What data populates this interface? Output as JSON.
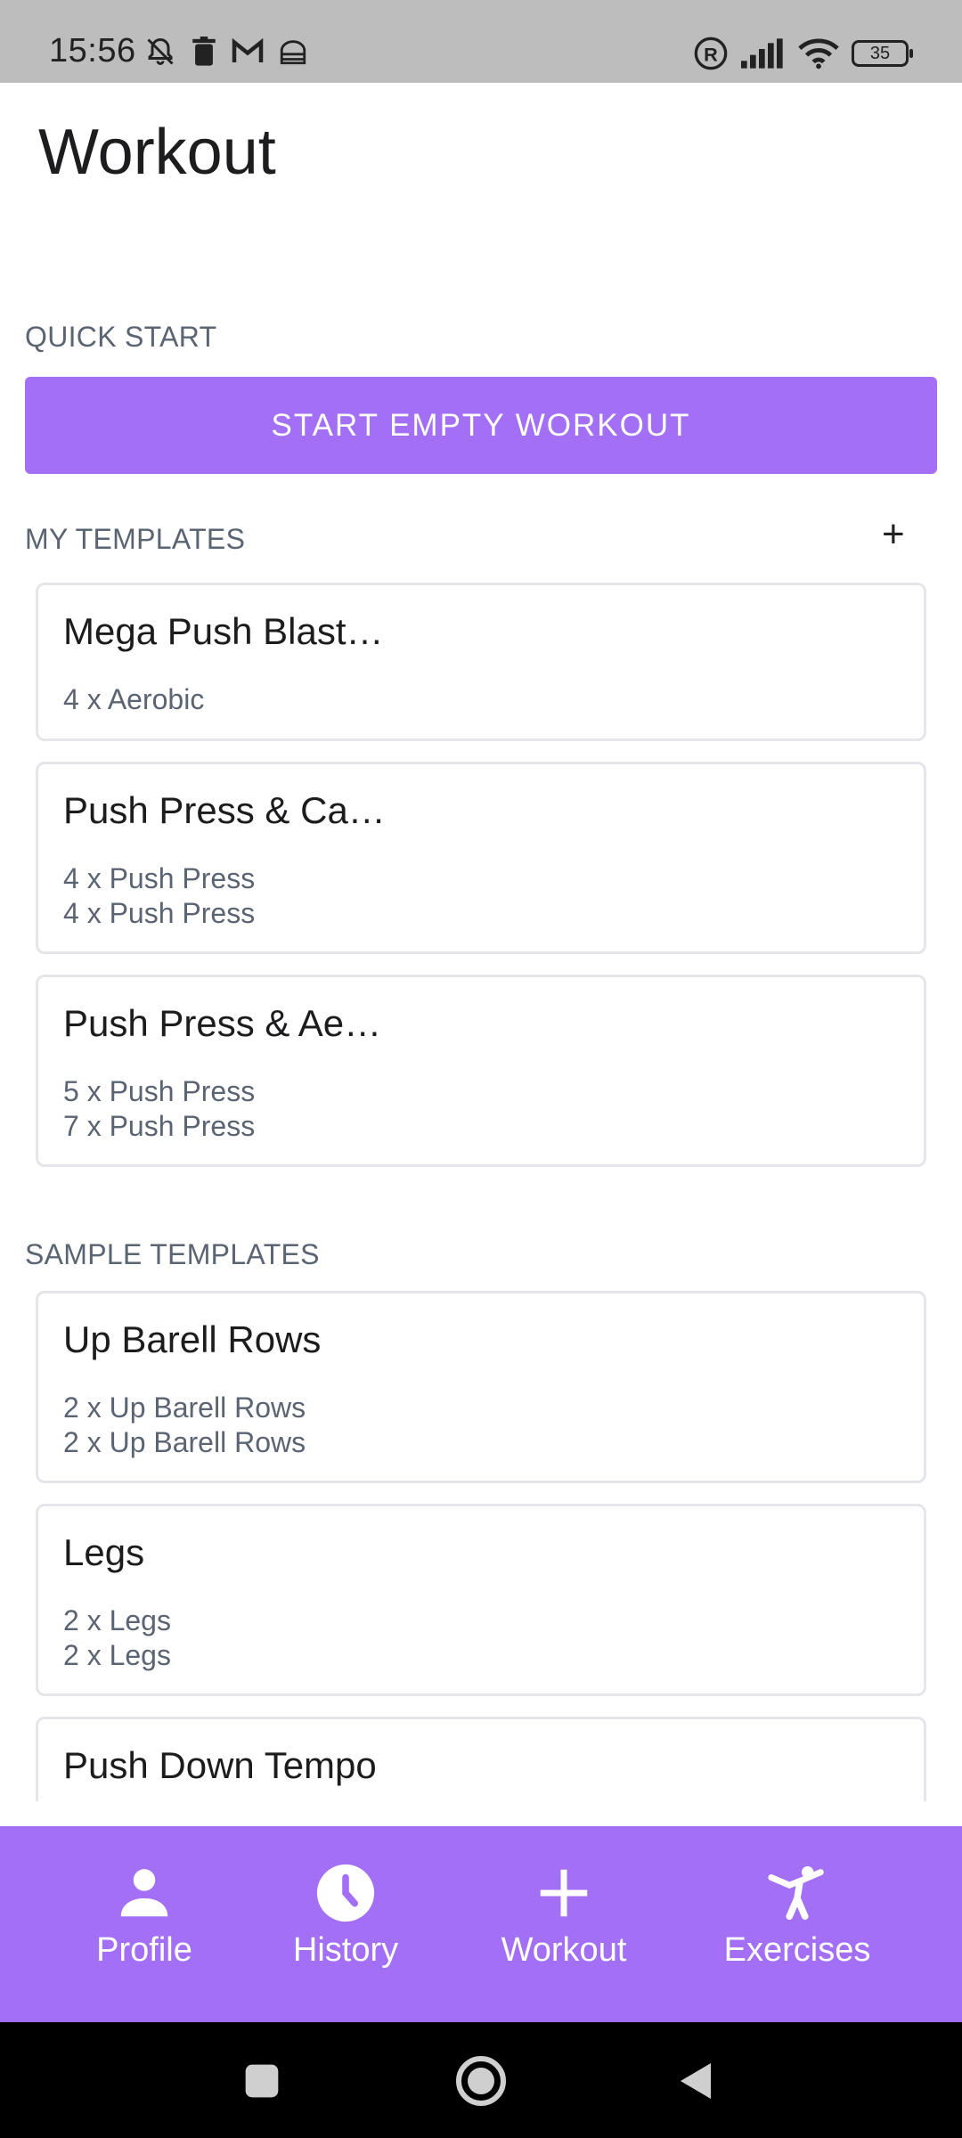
{
  "status_bar": {
    "time": "15:56",
    "battery": "35"
  },
  "header": {
    "title": "Workout"
  },
  "quick_start": {
    "label": "QUICK START",
    "button_label": "START EMPTY WORKOUT"
  },
  "my_templates": {
    "label": "MY TEMPLATES",
    "add_label": "+",
    "items": [
      {
        "title": "Mega Push Blast…",
        "lines": [
          "4 x Aerobic"
        ]
      },
      {
        "title": "Push Press & Ca…",
        "lines": [
          "4 x Push Press",
          "4 x Push Press"
        ]
      },
      {
        "title": "Push Press & Ae…",
        "lines": [
          "5 x Push Press",
          "7 x Push Press"
        ]
      }
    ]
  },
  "sample_templates": {
    "label": "SAMPLE TEMPLATES",
    "items": [
      {
        "title": "Up Barell Rows",
        "lines": [
          "2 x Up Barell Rows",
          "2 x Up Barell Rows"
        ]
      },
      {
        "title": "Legs",
        "lines": [
          "2 x Legs",
          "2 x Legs"
        ]
      },
      {
        "title": "Push Down Tempo",
        "lines": []
      }
    ]
  },
  "bottom_nav": {
    "items": [
      {
        "label": "Profile",
        "icon": "person-icon"
      },
      {
        "label": "History",
        "icon": "clock-icon"
      },
      {
        "label": "Workout",
        "icon": "plus-icon"
      },
      {
        "label": "Exercises",
        "icon": "exercise-figure-icon"
      }
    ]
  },
  "colors": {
    "accent": "#a36ff5",
    "status_bar": "#bdbdbd",
    "card_border": "#e4e6ea",
    "secondary_text": "#5b6472"
  }
}
